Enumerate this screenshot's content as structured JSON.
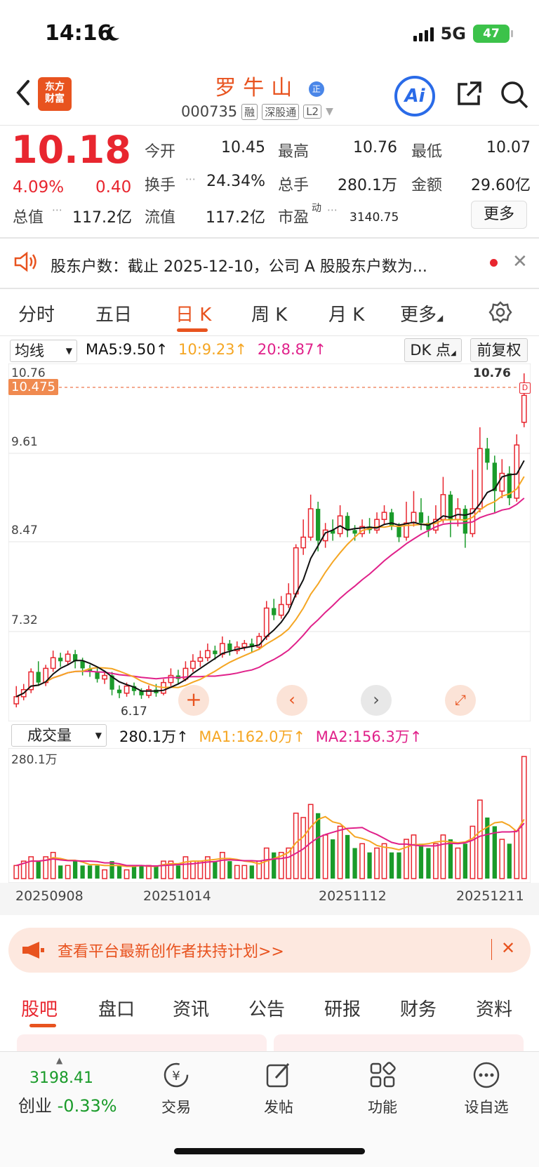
{
  "status_bar": {
    "time": "14:16",
    "network": "5G",
    "battery": "47"
  },
  "header": {
    "logo_text_line1": "东方",
    "logo_text_line2": "财富",
    "stock_name": "罗牛山",
    "stock_badge": "正",
    "stock_code": "000735",
    "tags": [
      "融",
      "深股通",
      "L2"
    ],
    "ai_label": "Ai"
  },
  "quote": {
    "price": "10.18",
    "change_pct": "4.09%",
    "change_amt": "0.40",
    "fields": {
      "open_label": "今开",
      "open": "10.45",
      "high_label": "最高",
      "high": "10.76",
      "low_label": "最低",
      "low": "10.07",
      "turnover_label": "换手",
      "turnover": "24.34%",
      "volume_label": "总手",
      "volume": "280.1万",
      "amount_label": "金额",
      "amount": "29.60亿",
      "mktcap_label": "总值",
      "mktcap": "117.2亿",
      "float_label": "流值",
      "float": "117.2亿",
      "pe_label": "市盈",
      "pe_sup": "动",
      "pe": "3140.75"
    },
    "more_label": "更多"
  },
  "notice": {
    "text": "股东户数：截止 2025-12-10，公司 A 股股东户数为..."
  },
  "chart_tabs": [
    "分时",
    "五日",
    "日 K",
    "周 K",
    "月 K",
    "更多"
  ],
  "active_chart_tab": "日 K",
  "kline_toolbar": {
    "indicator": "均线",
    "ma5": "MA5:9.50",
    "ma10": "10:9.23",
    "ma20": "20:8.87",
    "dk_label": "DK 点",
    "fq_label": "前复权"
  },
  "price_axis": {
    "labels": [
      "10.76",
      "9.61",
      "8.47",
      "7.32",
      "6.17"
    ],
    "marker": "10.475",
    "high_marker": "10.76",
    "low_marker": "6.17"
  },
  "volume_toolbar": {
    "indicator": "成交量",
    "vol": "280.1万",
    "ma1": "MA1:162.0万",
    "ma2": "MA2:156.3万",
    "axis_max": "280.1万"
  },
  "date_labels": [
    "20250908",
    "20251014",
    "20251112",
    "20251211"
  ],
  "promo": {
    "text": "查看平台最新创作者扶持计划>>"
  },
  "content_tabs": [
    "股吧",
    "盘口",
    "资讯",
    "公告",
    "研报",
    "财务",
    "资料"
  ],
  "bottom_nav": {
    "index_value": "3198.41",
    "index_name": "创业",
    "index_change": "-0.33%",
    "items": [
      "交易",
      "发帖",
      "功能",
      "设自选"
    ]
  },
  "colors": {
    "up": "#e8262f",
    "down": "#1a9b2a",
    "accent": "#e8531f",
    "ma5": "#111111",
    "ma10": "#f5a623",
    "ma20": "#e0218a"
  },
  "chart_data": {
    "type": "candlestick",
    "ylim": [
      6.17,
      10.76
    ],
    "candles": [
      [
        6.1,
        6.2,
        6.35,
        6.05,
        3
      ],
      [
        6.2,
        6.3,
        6.38,
        6.15,
        4
      ],
      [
        6.3,
        6.55,
        6.6,
        6.25,
        5
      ],
      [
        6.55,
        6.4,
        6.7,
        6.35,
        4
      ],
      [
        6.4,
        6.6,
        6.65,
        6.35,
        5
      ],
      [
        6.6,
        6.75,
        6.85,
        6.55,
        6
      ],
      [
        6.75,
        6.7,
        6.82,
        6.62,
        3
      ],
      [
        6.7,
        6.8,
        6.85,
        6.65,
        3
      ],
      [
        6.8,
        6.7,
        6.86,
        6.6,
        4
      ],
      [
        6.7,
        6.6,
        6.75,
        6.5,
        3
      ],
      [
        6.6,
        6.55,
        6.65,
        6.48,
        3
      ],
      [
        6.55,
        6.45,
        6.6,
        6.4,
        3
      ],
      [
        6.45,
        6.5,
        6.55,
        6.38,
        2
      ],
      [
        6.5,
        6.3,
        6.55,
        6.22,
        4
      ],
      [
        6.3,
        6.25,
        6.36,
        6.18,
        3
      ],
      [
        6.25,
        6.35,
        6.4,
        6.2,
        2
      ],
      [
        6.35,
        6.28,
        6.4,
        6.22,
        3
      ],
      [
        6.28,
        6.22,
        6.32,
        6.17,
        3
      ],
      [
        6.22,
        6.3,
        6.36,
        6.18,
        3
      ],
      [
        6.3,
        6.25,
        6.38,
        6.2,
        3
      ],
      [
        6.25,
        6.4,
        6.45,
        6.22,
        4
      ],
      [
        6.4,
        6.5,
        6.6,
        6.35,
        4
      ],
      [
        6.5,
        6.45,
        6.58,
        6.38,
        3
      ],
      [
        6.45,
        6.6,
        6.7,
        6.42,
        5
      ],
      [
        6.6,
        6.7,
        6.8,
        6.55,
        4
      ],
      [
        6.7,
        6.75,
        6.85,
        6.62,
        4
      ],
      [
        6.75,
        6.85,
        6.95,
        6.7,
        5
      ],
      [
        6.85,
        6.8,
        6.92,
        6.72,
        4
      ],
      [
        6.8,
        6.95,
        7.05,
        6.75,
        6
      ],
      [
        6.95,
        6.85,
        7.0,
        6.78,
        4
      ],
      [
        6.85,
        6.9,
        6.98,
        6.8,
        3
      ],
      [
        6.9,
        6.95,
        7.0,
        6.85,
        3
      ],
      [
        6.95,
        6.9,
        7.02,
        6.82,
        3
      ],
      [
        6.9,
        7.05,
        7.1,
        6.86,
        4
      ],
      [
        7.05,
        7.45,
        7.55,
        7.0,
        7
      ],
      [
        7.45,
        7.35,
        7.58,
        7.28,
        6
      ],
      [
        7.35,
        7.5,
        7.62,
        7.3,
        6
      ],
      [
        7.5,
        7.65,
        7.8,
        7.45,
        7
      ],
      [
        7.65,
        8.3,
        8.35,
        7.6,
        15
      ],
      [
        8.3,
        8.45,
        8.7,
        8.2,
        14
      ],
      [
        8.45,
        8.85,
        9.05,
        8.4,
        17
      ],
      [
        8.85,
        8.4,
        8.95,
        8.25,
        15
      ],
      [
        8.4,
        8.55,
        8.65,
        8.3,
        10
      ],
      [
        8.55,
        8.5,
        8.7,
        8.4,
        9
      ],
      [
        8.5,
        8.75,
        8.9,
        8.45,
        12
      ],
      [
        8.75,
        8.55,
        8.8,
        8.45,
        10
      ],
      [
        8.55,
        8.5,
        8.62,
        8.4,
        7
      ],
      [
        8.5,
        8.6,
        8.7,
        8.45,
        8
      ],
      [
        8.6,
        8.55,
        8.72,
        8.5,
        6
      ],
      [
        8.55,
        8.7,
        8.8,
        8.5,
        7
      ],
      [
        8.7,
        8.8,
        8.9,
        8.62,
        8
      ],
      [
        8.8,
        8.6,
        8.85,
        8.55,
        6
      ],
      [
        8.6,
        8.45,
        8.65,
        8.38,
        6
      ],
      [
        8.45,
        8.65,
        8.95,
        8.4,
        9
      ],
      [
        8.65,
        8.8,
        9.1,
        8.6,
        10
      ],
      [
        8.8,
        8.65,
        9.0,
        8.55,
        8
      ],
      [
        8.65,
        8.55,
        8.75,
        8.45,
        7
      ],
      [
        8.55,
        8.7,
        8.9,
        8.5,
        8
      ],
      [
        8.7,
        9.05,
        9.3,
        8.65,
        10
      ],
      [
        9.05,
        8.7,
        9.1,
        8.45,
        9
      ],
      [
        8.7,
        8.85,
        9.0,
        8.6,
        7
      ],
      [
        8.85,
        8.5,
        8.9,
        8.3,
        8
      ],
      [
        8.5,
        8.85,
        9.4,
        8.45,
        12
      ],
      [
        8.85,
        9.7,
        10.0,
        8.8,
        18
      ],
      [
        9.7,
        9.5,
        9.85,
        9.4,
        14
      ],
      [
        9.5,
        9.1,
        9.6,
        8.8,
        12
      ],
      [
        9.1,
        9.35,
        9.55,
        9.0,
        9
      ],
      [
        9.35,
        9.0,
        9.45,
        8.9,
        8
      ],
      [
        9.0,
        9.75,
        9.9,
        8.95,
        11
      ],
      [
        10.07,
        10.45,
        10.76,
        10.0,
        28
      ]
    ]
  }
}
